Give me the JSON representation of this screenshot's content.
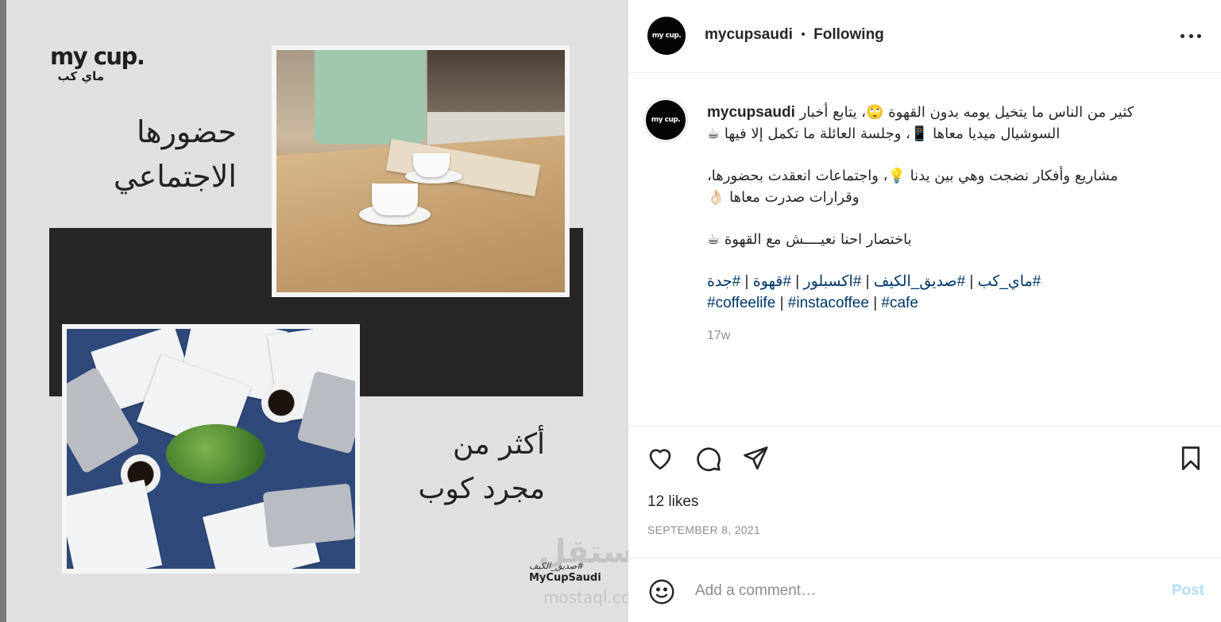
{
  "post_image": {
    "brand_en": "my cup.",
    "brand_ar": "ماي كب",
    "headline_top_line1": "حضورها",
    "headline_top_line2": "الاجتماعي",
    "headline_bottom_line1": "أكثر من",
    "headline_bottom_line2": "مجرد كوب",
    "tagline_ar": "#صديق_الكيف",
    "tagline_en": "MyCupSaudi",
    "watermark_ar": "مستقل",
    "watermark_url": "mostaql.com"
  },
  "header": {
    "avatar_text": "my cup.",
    "username": "mycupsaudi",
    "separator": "•",
    "follow_status": "Following",
    "more_icon": "more-horizontal-icon"
  },
  "caption": {
    "avatar_text": "my cup.",
    "username": "mycupsaudi",
    "line1": "كثير من الناس ما يتخيل يومه بدون القهوة 🙄، يتابع أخبار",
    "line2": "السوشيال ميديا معاها 📱، وجلسة العائلة ما تكمل إلا فيها ☕",
    "line3": "مشاريع وأفكار نضجت وهي بين يدنا 💡، واجتماعات انعقدت بحضورها،",
    "line4": "وقرارات صدرت معاها 👌🏻",
    "line5": "باختصار احنا نعيــــش مع القهوة ☕",
    "hashtags_row1": [
      "#جدة",
      "#قهوة",
      "#اكسبلور",
      "#صديق_الكيف",
      "#ماي_كب"
    ],
    "hashtags_row2": [
      "#coffeelife",
      "#instacoffee",
      "#cafe"
    ],
    "hashtag_separator": "|",
    "time_ago": "17w"
  },
  "actions": {
    "like_icon": "heart-icon",
    "comment_icon": "comment-icon",
    "share_icon": "paper-plane-icon",
    "save_icon": "bookmark-icon"
  },
  "likes": "12 likes",
  "date": "SEPTEMBER 8, 2021",
  "comment": {
    "placeholder": "Add a comment…",
    "value": "",
    "post_label": "Post",
    "emoji_icon": "smiley-icon"
  },
  "colors": {
    "hashtag": "#00376b",
    "muted": "#8e8e8e",
    "post_button_disabled": "#b2dffc",
    "image_bg": "#e0e0e0",
    "dark_band": "#272525"
  }
}
